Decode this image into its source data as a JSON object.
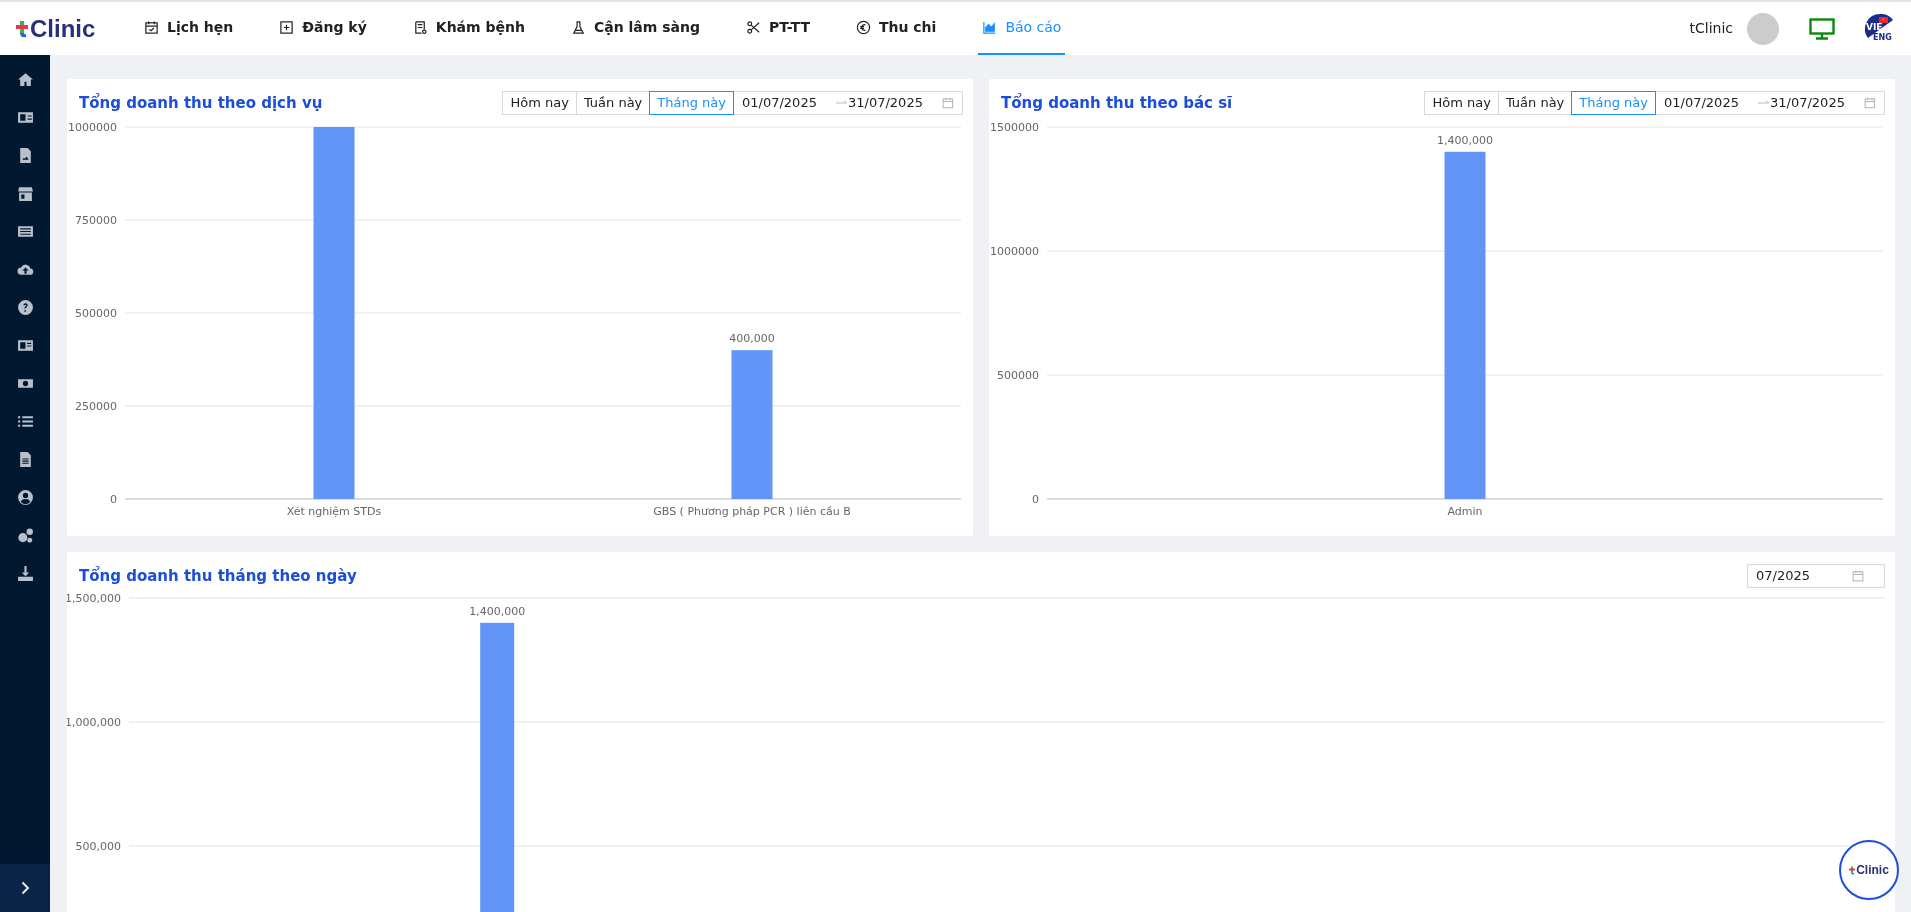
{
  "header": {
    "logo": "Clinic",
    "nav": [
      {
        "label": "Lịch hẹn",
        "selected": false
      },
      {
        "label": "Đăng ký",
        "selected": false
      },
      {
        "label": "Khám bệnh",
        "selected": false
      },
      {
        "label": "Cận lâm sàng",
        "selected": false
      },
      {
        "label": "PT-TT",
        "selected": false
      },
      {
        "label": "Thu chi",
        "selected": false
      },
      {
        "label": "Báo cáo",
        "selected": true
      }
    ],
    "user": "tClinic",
    "language": {
      "primary": "VIE",
      "secondary": "ENG"
    }
  },
  "panels": [
    {
      "title": "Tổng doanh thu theo dịch vụ",
      "range": {
        "presets": [
          {
            "label": "Hôm nay",
            "selected": false
          },
          {
            "label": "Tuần này",
            "selected": false
          },
          {
            "label": "Tháng này",
            "selected": true
          }
        ],
        "start": "01/07/2025",
        "end": "31/07/2025"
      },
      "chart_data": {
        "type": "bar",
        "grid": true,
        "categories": [
          "Xét nghiệm STDs",
          "GBS ( Phương pháp PCR ) liên cầu B"
        ],
        "series": [
          {
            "color": "#6395f9",
            "values": [
              1000000,
              400000
            ]
          }
        ],
        "ylim": [
          0,
          1000000
        ],
        "yticks": [
          0,
          250000,
          500000,
          750000,
          1000000
        ],
        "value_labels": [
          null,
          "400,000"
        ]
      }
    },
    {
      "title": "Tổng doanh thu theo bác sĩ",
      "range": {
        "presets": [
          {
            "label": "Hôm nay",
            "selected": false
          },
          {
            "label": "Tuần này",
            "selected": false
          },
          {
            "label": "Tháng này",
            "selected": true
          }
        ],
        "start": "01/07/2025",
        "end": "31/07/2025"
      },
      "chart_data": {
        "type": "bar",
        "grid": true,
        "categories": [
          "Admin"
        ],
        "series": [
          {
            "color": "#6395f9",
            "values": [
              1400000
            ]
          }
        ],
        "ylim": [
          0,
          1500000
        ],
        "yticks": [
          0,
          500000,
          1000000,
          1500000
        ],
        "value_labels": [
          "1,400,000"
        ]
      }
    },
    {
      "title": "Tổng doanh thu tháng theo ngày",
      "month": "07/2025",
      "chart_data": {
        "type": "bar",
        "grid": true,
        "series": [
          {
            "color": "#6395f9",
            "values": [
              null,
              null,
              null,
              null,
              null,
              null,
              1400000,
              null,
              null,
              null,
              null,
              null,
              null,
              null,
              null,
              null,
              null,
              null,
              null,
              null,
              null,
              null,
              null,
              null,
              null,
              null,
              null,
              null,
              null,
              null,
              null
            ]
          }
        ],
        "ylim": [
          0,
          1500000
        ],
        "yticks": [
          {
            "value": 500000,
            "label": "500,000"
          },
          {
            "value": 1000000,
            "label": "1,000,000"
          },
          {
            "value": 1500000,
            "label": "1,500,000"
          }
        ],
        "value_labels": [
          null,
          null,
          null,
          null,
          null,
          null,
          "1,400,000",
          null,
          null,
          null,
          null,
          null,
          null,
          null,
          null,
          null,
          null,
          null,
          null,
          null,
          null,
          null,
          null,
          null,
          null,
          null,
          null,
          null,
          null,
          null,
          null
        ]
      }
    }
  ],
  "fab": {
    "label": "Clinic"
  }
}
